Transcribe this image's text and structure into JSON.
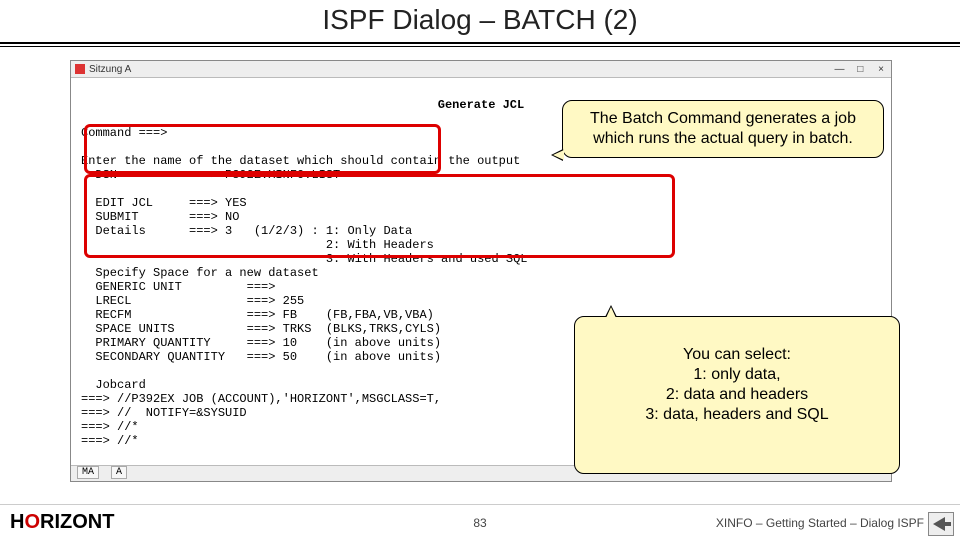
{
  "slide": {
    "title": "ISPF Dialog – BATCH (2)",
    "page_number": "83"
  },
  "footer": {
    "brand_left": "H",
    "brand_red": "O",
    "brand_rest": "RIZONT",
    "right_text": "XINFO – Getting Started – Dialog ISPF"
  },
  "window": {
    "session_label": "Sitzung A",
    "min": "—",
    "max": "□",
    "close": "×",
    "status_left": "MA",
    "status_right": "A"
  },
  "term": {
    "header": "Generate JCL",
    "line_cmd": "Command ===>",
    "line_enter": "Enter the name of the dataset which should contain the output",
    "line_dsn": "  DSN          ===> P392E.XINFO.LIST",
    "line_blank1": "",
    "line_editjcl": "  EDIT JCL     ===> YES",
    "line_submit": "  SUBMIT       ===> NO",
    "line_details": "  Details      ===> 3   (1/2/3) : 1: Only Data",
    "line_details2": "                                  2: With Headers",
    "line_details3": "                                  3: With Headers and used SQL",
    "line_specify": "  Specify Space for a new dataset",
    "line_genunit": "  GENERIC UNIT         ===>",
    "line_lrecl": "  LRECL                ===> 255",
    "line_recfm": "  RECFM                ===> FB    (FB,FBA,VB,VBA)",
    "line_spunits": "  SPACE UNITS          ===> TRKS  (BLKS,TRKS,CYLS)",
    "line_priqty": "  PRIMARY QUANTITY     ===> 10    (in above units)",
    "line_secqty": "  SECONDARY QUANTITY   ===> 50    (in above units)",
    "line_blank2": "",
    "line_jobcard": "  Jobcard",
    "line_j1": "===> //P392EX JOB (ACCOUNT),'HORIZONT',MSGCLASS=T,",
    "line_j2": "===> //  NOTIFY=&SYSUID",
    "line_j3": "===> //*",
    "line_j4": "===> //*"
  },
  "callouts": {
    "c1": "The Batch Command generates a job which runs the actual query in batch.",
    "c2": "You can select:\n1: only data,\n2: data and headers\n3: data, headers and SQL"
  }
}
